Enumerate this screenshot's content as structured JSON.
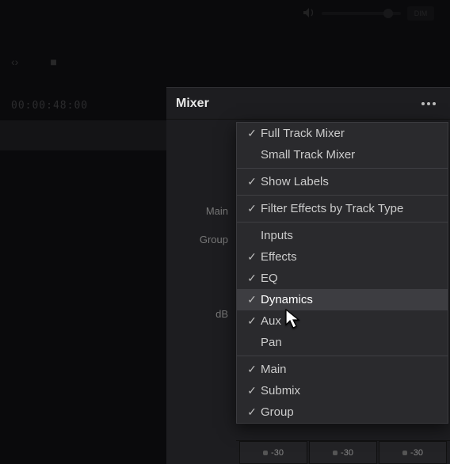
{
  "background": {
    "timecode": "00:00:48:00",
    "dim_label": "DIM"
  },
  "mixer": {
    "title": "Mixer",
    "labels": {
      "main": "Main",
      "group": "Group",
      "db": "dB"
    },
    "faders": [
      "-30",
      "-30",
      "-30"
    ]
  },
  "menu": {
    "sections": [
      [
        {
          "label": "Full Track Mixer",
          "checked": true
        },
        {
          "label": "Small Track Mixer",
          "checked": false
        }
      ],
      [
        {
          "label": "Show Labels",
          "checked": true
        }
      ],
      [
        {
          "label": "Filter Effects by Track Type",
          "checked": true
        }
      ],
      [
        {
          "label": "Inputs",
          "checked": false
        },
        {
          "label": "Effects",
          "checked": true
        },
        {
          "label": "EQ",
          "checked": true
        },
        {
          "label": "Dynamics",
          "checked": true,
          "highlight": true
        },
        {
          "label": "Aux",
          "checked": true
        },
        {
          "label": "Pan",
          "checked": false
        }
      ],
      [
        {
          "label": "Main",
          "checked": true
        },
        {
          "label": "Submix",
          "checked": true
        },
        {
          "label": "Group",
          "checked": true
        }
      ]
    ]
  }
}
